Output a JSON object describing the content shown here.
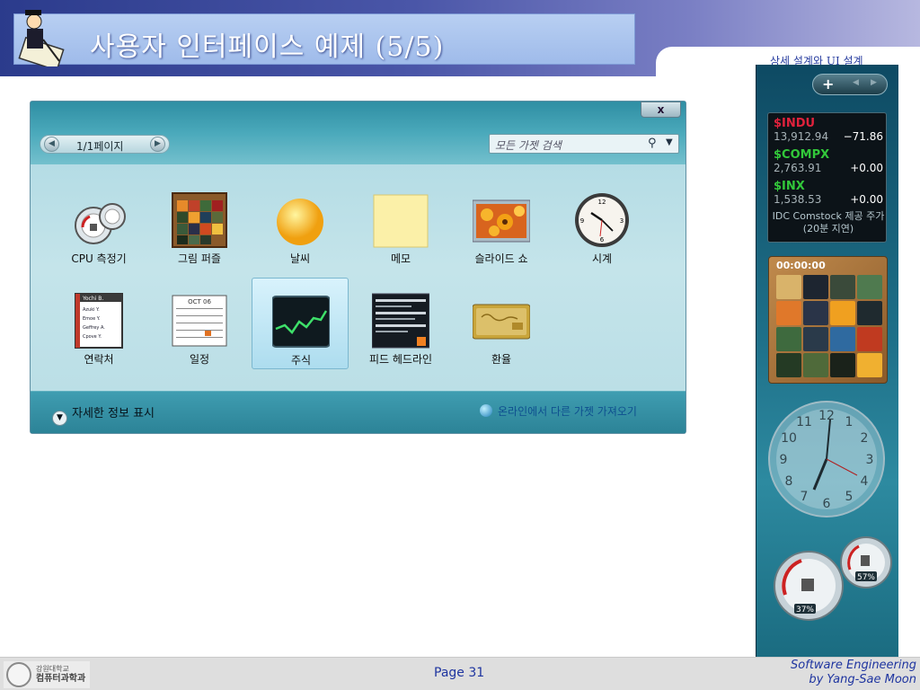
{
  "header": {
    "title": "사용자 인터페이스 예제 (5/5)",
    "subtitle": "상세 설계와 UI 설계"
  },
  "gallery": {
    "close_label": "x",
    "pager_label": "1/1페이지",
    "search_placeholder": "모든 가젯 검색",
    "tiles": [
      {
        "label": "CPU 측정기",
        "icon": "cpu-meter-icon"
      },
      {
        "label": "그림 퍼즐",
        "icon": "picture-puzzle-icon"
      },
      {
        "label": "날씨",
        "icon": "weather-sun-icon"
      },
      {
        "label": "메모",
        "icon": "sticky-note-icon"
      },
      {
        "label": "슬라이드 쇼",
        "icon": "slideshow-icon"
      },
      {
        "label": "시계",
        "icon": "clock-icon"
      },
      {
        "label": "연락처",
        "icon": "contacts-icon"
      },
      {
        "label": "일정",
        "icon": "calendar-icon"
      },
      {
        "label": "주식",
        "icon": "stocks-icon",
        "selected": true
      },
      {
        "label": "피드 헤드라인",
        "icon": "feed-headlines-icon"
      },
      {
        "label": "환율",
        "icon": "currency-icon"
      }
    ],
    "details_label": "자세한 정보 표시",
    "online_label": "온라인에서 다른 가젯 가져오기",
    "contacts_names": [
      "Yochi B.",
      "Azuki Y.",
      "Emoe Y.",
      "Geffrey A.",
      "Cpove Y."
    ],
    "calendar_month": "OCT 06"
  },
  "sidebar": {
    "add_label": "+",
    "stocks": [
      {
        "symbol": "$INDU",
        "price": "13,912.94",
        "change": "−71.86",
        "color": "#e0223c"
      },
      {
        "symbol": "$COMPX",
        "price": "2,763.91",
        "change": "+0.00",
        "color": "#32c83a"
      },
      {
        "symbol": "$INX",
        "price": "1,538.53",
        "change": "+0.00",
        "color": "#32c83a"
      }
    ],
    "stock_note": "IDC Comstock 제공 주가(20분 지연)",
    "puzzle_timer": "00:00:00",
    "clock_numbers": [
      "12",
      "1",
      "2",
      "3",
      "4",
      "5",
      "6",
      "7",
      "8",
      "9",
      "10",
      "11"
    ],
    "cpu_percent": "37%",
    "mem_percent": "57%"
  },
  "footer": {
    "univ_line1": "강원대학교",
    "univ_line2": "컴퓨터과학과",
    "page": "Page 31",
    "author_line1": "Software Engineering",
    "author_line2": "by Yang-Sae Moon"
  },
  "colors": {
    "accent": "#1f35a0",
    "header_band": "#2b3b8c",
    "gallery_bg": "#b2dbe4",
    "sidebar_bg": "#1e6f88"
  }
}
